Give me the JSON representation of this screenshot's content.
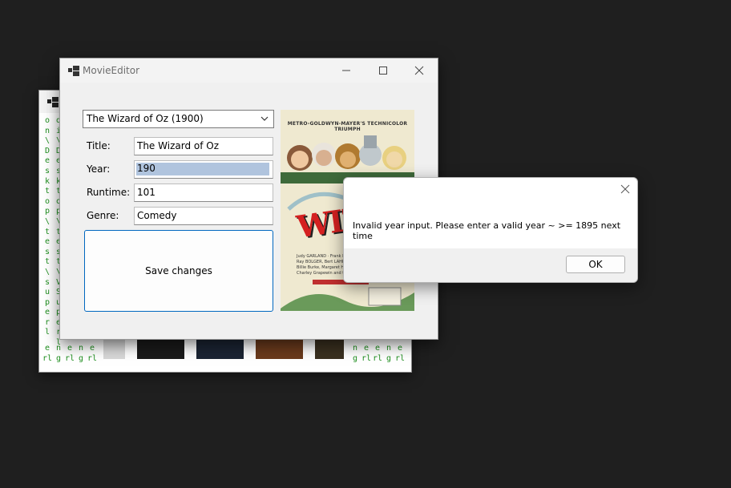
{
  "background_window": {
    "columns": [
      {
        "text": "o\nn\n\\\nD\ne\ns\nk\nt\no\np\n\\\nt\ne\ns\nt\n\\\ns\nu\np\ne\nr\nl",
        "x": 0
      },
      {
        "text": "d\ni\n\\\nD\ne\ns\nk\nt\no\np\n\\\nt\ne\ns\nt\n\\\nV\nS\nu\np\ne\nr\nl",
        "x": 0
      }
    ],
    "bottom_letters": [
      "e\nrl",
      "n\ng",
      "e\nrl",
      "n\ng",
      "e\nrl",
      "n\ng",
      "e\nrl",
      "e\nrl",
      "n\ng",
      "e\nrl"
    ]
  },
  "main_window": {
    "title": "MovieEditor",
    "movie_select": "The Wizard of Oz (1900)",
    "fields": [
      {
        "label": "Title:",
        "value": "The Wizard of Oz"
      },
      {
        "label": "Year:",
        "value": "190"
      },
      {
        "label": "Runtime:",
        "value": "101"
      },
      {
        "label": "Genre:",
        "value": "Comedy"
      }
    ],
    "save_label": "Save changes",
    "poster": {
      "header": "METRO-GOLDWYN-MAYER'S TECHNICOLOR TRIUMPH",
      "logo": "WIZ",
      "credits": [
        "Judy GARLAND · Frank MORGAN",
        "Ray BOLGER, Bert LAHR, Jack HALEY",
        "Billie Burke, Margaret Hamilton",
        "Charley Grapewin and the Munchkins"
      ]
    }
  },
  "dialog": {
    "message": "Invalid year input. Please enter a valid year ~ >= 1895 next time",
    "ok_label": "OK"
  },
  "colors": {
    "accent": "#0067c0",
    "selection": "#b0c4de",
    "desktop": "#1f1f1f"
  }
}
